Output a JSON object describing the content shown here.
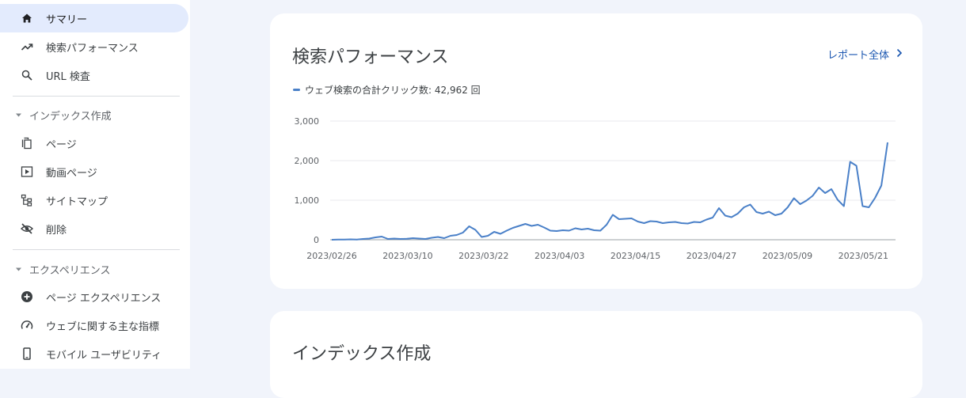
{
  "sidebar": {
    "items": [
      {
        "label": "サマリー",
        "icon": "home-icon",
        "active": true
      },
      {
        "label": "検索パフォーマンス",
        "icon": "trending-up-icon"
      },
      {
        "label": "URL 検査",
        "icon": "search-icon"
      }
    ],
    "sections": [
      {
        "title": "インデックス作成",
        "items": [
          {
            "label": "ページ",
            "icon": "pages-icon"
          },
          {
            "label": "動画ページ",
            "icon": "video-page-icon"
          },
          {
            "label": "サイトマップ",
            "icon": "sitemap-icon"
          },
          {
            "label": "削除",
            "icon": "eye-off-icon"
          }
        ]
      },
      {
        "title": "エクスペリエンス",
        "items": [
          {
            "label": "ページ エクスペリエンス",
            "icon": "plus-circle-icon"
          },
          {
            "label": "ウェブに関する主な指標",
            "icon": "speedometer-icon"
          },
          {
            "label": "モバイル ユーザビリティ",
            "icon": "smartphone-icon"
          }
        ]
      }
    ]
  },
  "performance_card": {
    "title": "検索パフォーマンス",
    "report_link": "レポート全体",
    "legend": "ウェブ検索の合計クリック数: 42,962 回"
  },
  "index_card": {
    "title": "インデックス作成"
  },
  "colors": {
    "accent": "#4a80c8",
    "active_bg": "#e3ebfd",
    "link": "#1a56b0"
  },
  "chart_data": {
    "type": "line",
    "series": [
      {
        "name": "ウェブ検索の合計クリック数",
        "values": [
          0,
          5,
          5,
          10,
          5,
          20,
          30,
          60,
          80,
          20,
          30,
          20,
          25,
          40,
          30,
          20,
          50,
          70,
          40,
          100,
          120,
          180,
          340,
          250,
          70,
          100,
          200,
          150,
          230,
          300,
          350,
          400,
          350,
          380,
          310,
          230,
          220,
          240,
          230,
          290,
          260,
          280,
          240,
          230,
          380,
          630,
          520,
          530,
          540,
          460,
          420,
          470,
          460,
          420,
          440,
          450,
          420,
          410,
          450,
          440,
          510,
          560,
          800,
          610,
          570,
          660,
          820,
          890,
          700,
          660,
          710,
          620,
          660,
          820,
          1050,
          900,
          990,
          1110,
          1320,
          1180,
          1280,
          1010,
          850,
          1970,
          1870,
          850,
          820,
          1060,
          1370,
          2460
        ]
      }
    ],
    "x_tick_labels": [
      "2023/02/26",
      "2023/03/10",
      "2023/03/22",
      "2023/04/03",
      "2023/04/15",
      "2023/04/27",
      "2023/05/09",
      "2023/05/21"
    ],
    "y_ticks": [
      "0",
      "1,000",
      "2,000",
      "3,000"
    ],
    "ylim": [
      0,
      3000
    ],
    "grid": true,
    "legend_position": "top-left"
  }
}
